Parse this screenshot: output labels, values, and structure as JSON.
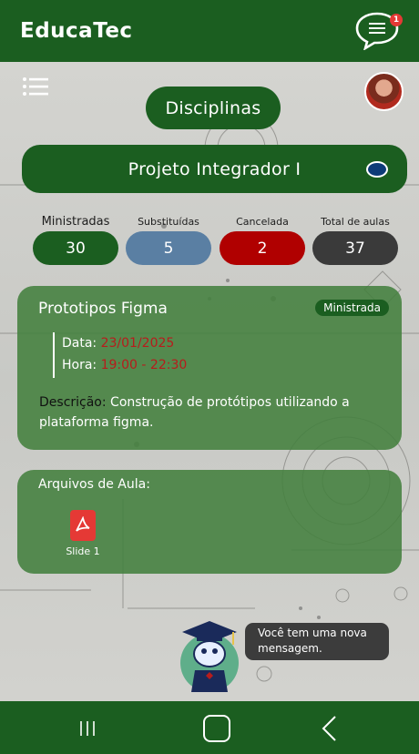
{
  "app": {
    "title": "EducaTec"
  },
  "header": {
    "chat_badge_count": "1",
    "chat_icon": "chat-bubble-icon",
    "menu_icon": "hamburger-menu-icon"
  },
  "page": {
    "title": "Disciplinas"
  },
  "course": {
    "name": "Projeto Integrador I",
    "color": "#0d3b78"
  },
  "stats": [
    {
      "label": "Ministradas",
      "value": "30",
      "color": "#1b5e20"
    },
    {
      "label": "Substituídas",
      "value": "5",
      "color": "#5a7fa3"
    },
    {
      "label": "Cancelada",
      "value": "2",
      "color": "#b00000"
    },
    {
      "label": "Total de aulas",
      "value": "37",
      "color": "#3a3a3a"
    }
  ],
  "class_card": {
    "title": "Prototipos Figma",
    "status": "Ministrada",
    "date_label": "Data:",
    "date_value": "23/01/2025",
    "time_label": "Hora:",
    "time_value": "19:00 - 22:30",
    "desc_label": "Descrição:",
    "desc_value": "Construção de protótipos utilizando a plataforma figma."
  },
  "files_card": {
    "title": "Arquivos de Aula:",
    "files": [
      {
        "label": "Slide 1",
        "icon": "pdf-icon"
      }
    ]
  },
  "assistant": {
    "message": "Você tem uma nova mensagem."
  },
  "colors": {
    "primary": "#1b5e20",
    "card": "#43803d",
    "danger": "#b71c1c"
  }
}
